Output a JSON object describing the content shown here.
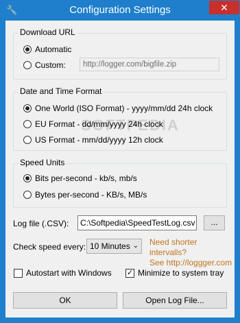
{
  "window": {
    "title": "Configuration Settings",
    "app_icon": "wrench-icon",
    "close_glyph": "✕"
  },
  "download_url": {
    "title": "Download URL",
    "options": [
      {
        "label": "Automatic",
        "selected": true
      },
      {
        "label": "Custom:",
        "selected": false
      }
    ],
    "url_value": "http://logger.com/bigfile.zip"
  },
  "date_format": {
    "title": "Date and Time Format",
    "options": [
      {
        "label": "One World (ISO Format) - yyyy/mm/dd 24h clock",
        "selected": true
      },
      {
        "label": "EU Format - dd/mm/yyyy 24h clock",
        "selected": false
      },
      {
        "label": "US Format - mm/dd/yyyy 12h clock",
        "selected": false
      }
    ]
  },
  "speed_units": {
    "title": "Speed Units",
    "options": [
      {
        "label": "Bits per-second - kb/s, mb/s",
        "selected": true
      },
      {
        "label": "Bytes per-second - KB/s, MB/s",
        "selected": false
      }
    ]
  },
  "log_file": {
    "label": "Log file (.CSV):",
    "value": "C:\\Softpedia\\SpeedTestLog.csv",
    "browse_label": "..."
  },
  "check_speed": {
    "label": "Check speed every:",
    "selected": "10 Minutes",
    "link_line1": "Need shorter intervalls?",
    "link_line2": "See http://loggger.com"
  },
  "options": {
    "autostart_label": "Autostart with Windows",
    "autostart_checked": false,
    "minimize_label": "Minimize to system tray",
    "minimize_checked": true
  },
  "buttons": {
    "ok_label": "OK",
    "open_log_label": "Open Log File..."
  },
  "watermark": "SOFTPEDIA",
  "colors": {
    "titlebar": "#1f7fcc",
    "close": "#c7302b",
    "link": "#c0731e"
  }
}
